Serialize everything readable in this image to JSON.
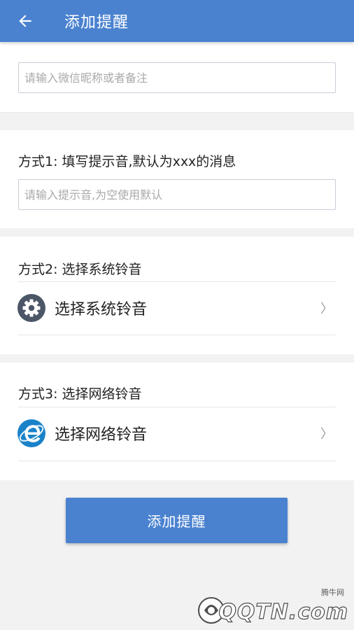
{
  "header": {
    "title": "添加提醒",
    "back_icon": "arrow-left-icon"
  },
  "nickname": {
    "placeholder": "请输入微信昵称或者备注",
    "value": ""
  },
  "method1": {
    "title": "方式1: 填写提示音,默认为xxx的消息",
    "placeholder": "请输入提示音,为空使用默认",
    "value": ""
  },
  "method2": {
    "title": "方式2: 选择系统铃音",
    "option_label": "选择系统铃音",
    "icon": "gear-icon",
    "chevron": "〉"
  },
  "method3": {
    "title": "方式3: 选择网络铃音",
    "option_label": "选择网络铃音",
    "icon": "browser-e-icon",
    "chevron": "〉"
  },
  "submit": {
    "label": "添加提醒"
  },
  "watermark": {
    "site_name": "腾牛网",
    "brand": "QQTN.com"
  },
  "colors": {
    "primary": "#4a82d0",
    "background": "#f2f2f2",
    "gear_icon": "#4b5667",
    "browser_icon": "#1a82c9"
  }
}
